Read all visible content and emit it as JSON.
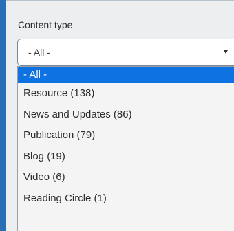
{
  "filter": {
    "label": "Content type",
    "selected_value": "- All -",
    "options": [
      {
        "label": "- All -",
        "selected": true
      },
      {
        "label": "Resource (138)",
        "selected": false
      },
      {
        "label": "News and Updates (86)",
        "selected": false
      },
      {
        "label": "Publication (79)",
        "selected": false
      },
      {
        "label": "Blog (19)",
        "selected": false
      },
      {
        "label": "Video (6)",
        "selected": false
      },
      {
        "label": "Reading Circle (1)",
        "selected": false
      }
    ]
  },
  "icons": {
    "dropdown_arrow": "caret-down-icon"
  },
  "colors": {
    "page_background": "#2a6fb5",
    "panel_background": "#eceeef",
    "selected_option": "#0f72e2"
  }
}
